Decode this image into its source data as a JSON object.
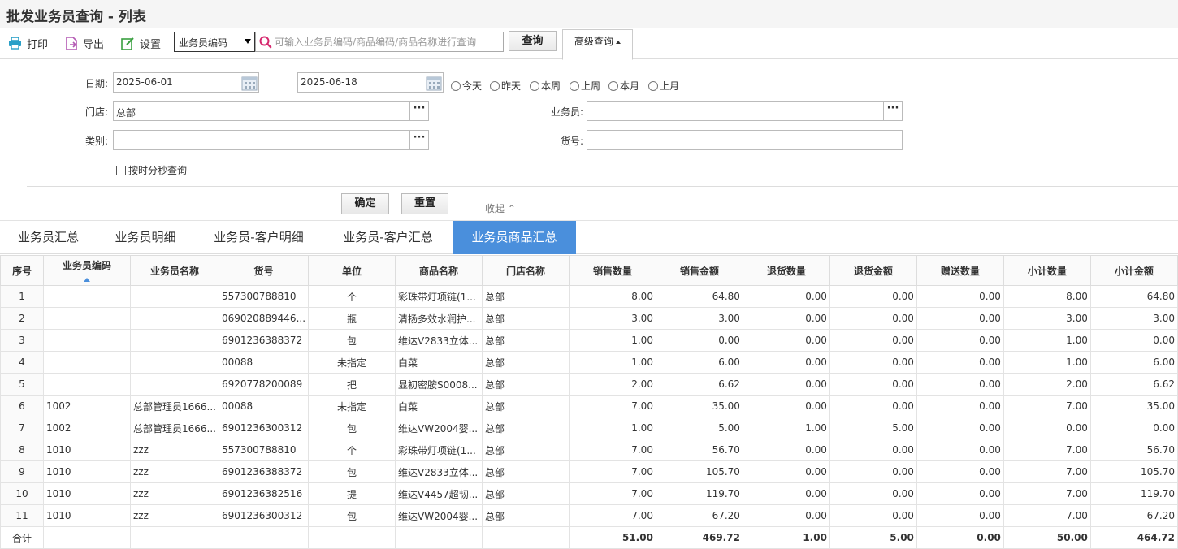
{
  "title": "批发业务员查询 - 列表",
  "toolbar": {
    "print": "打印",
    "export": "导出",
    "settings": "设置",
    "search_field": "业务员编码",
    "search_placeholder": "可输入业务员编码/商品编码/商品名称进行查询",
    "query": "查询",
    "advanced": "高级查询"
  },
  "filters": {
    "date_label": "日期:",
    "date_from": "2025-06-01",
    "date_sep": "--",
    "date_to": "2025-06-18",
    "quick": [
      "今天",
      "昨天",
      "本周",
      "上周",
      "本月",
      "上月"
    ],
    "store_label": "门店:",
    "store_value": "总部",
    "salesman_label": "业务员:",
    "salesman_value": "",
    "category_label": "类别:",
    "category_value": "",
    "item_no_label": "货号:",
    "item_no_value": "",
    "time_checkbox": "按时分秒查询",
    "confirm": "确定",
    "reset": "重置",
    "collapse": "收起"
  },
  "tabs": [
    "业务员汇总",
    "业务员明细",
    "业务员-客户明细",
    "业务员-客户汇总",
    "业务员商品汇总"
  ],
  "active_tab": 4,
  "table": {
    "headers": [
      "序号",
      "业务员编码",
      "业务员名称",
      "货号",
      "单位",
      "商品名称",
      "门店名称",
      "销售数量",
      "销售金额",
      "退货数量",
      "退货金额",
      "赠送数量",
      "小计数量",
      "小计金额"
    ],
    "rows": [
      [
        "1",
        "",
        "",
        "557300788810",
        "个",
        "彩珠带灯项链(1...",
        "总部",
        "8.00",
        "64.80",
        "0.00",
        "0.00",
        "0.00",
        "8.00",
        "64.80"
      ],
      [
        "2",
        "",
        "",
        "069020889446...",
        "瓶",
        "清扬多效水润护...",
        "总部",
        "3.00",
        "3.00",
        "0.00",
        "0.00",
        "0.00",
        "3.00",
        "3.00"
      ],
      [
        "3",
        "",
        "",
        "6901236388372",
        "包",
        "维达V2833立体...",
        "总部",
        "1.00",
        "0.00",
        "0.00",
        "0.00",
        "0.00",
        "1.00",
        "0.00"
      ],
      [
        "4",
        "",
        "",
        "00088",
        "未指定",
        "白菜",
        "总部",
        "1.00",
        "6.00",
        "0.00",
        "0.00",
        "0.00",
        "1.00",
        "6.00"
      ],
      [
        "5",
        "",
        "",
        "6920778200089",
        "把",
        "显初密胺S0008...",
        "总部",
        "2.00",
        "6.62",
        "0.00",
        "0.00",
        "0.00",
        "2.00",
        "6.62"
      ],
      [
        "6",
        "1002",
        "总部管理员1666...",
        "00088",
        "未指定",
        "白菜",
        "总部",
        "7.00",
        "35.00",
        "0.00",
        "0.00",
        "0.00",
        "7.00",
        "35.00"
      ],
      [
        "7",
        "1002",
        "总部管理员1666...",
        "6901236300312",
        "包",
        "维达VW2004婴...",
        "总部",
        "1.00",
        "5.00",
        "1.00",
        "5.00",
        "0.00",
        "0.00",
        "0.00"
      ],
      [
        "8",
        "1010",
        "zzz",
        "557300788810",
        "个",
        "彩珠带灯项链(1...",
        "总部",
        "7.00",
        "56.70",
        "0.00",
        "0.00",
        "0.00",
        "7.00",
        "56.70"
      ],
      [
        "9",
        "1010",
        "zzz",
        "6901236388372",
        "包",
        "维达V2833立体...",
        "总部",
        "7.00",
        "105.70",
        "0.00",
        "0.00",
        "0.00",
        "7.00",
        "105.70"
      ],
      [
        "10",
        "1010",
        "zzz",
        "6901236382516",
        "提",
        "维达V4457超韧...",
        "总部",
        "7.00",
        "119.70",
        "0.00",
        "0.00",
        "0.00",
        "7.00",
        "119.70"
      ],
      [
        "11",
        "1010",
        "zzz",
        "6901236300312",
        "包",
        "维达VW2004婴...",
        "总部",
        "7.00",
        "67.20",
        "0.00",
        "0.00",
        "0.00",
        "7.00",
        "67.20"
      ]
    ],
    "total_label": "合计",
    "totals": [
      "51.00",
      "469.72",
      "1.00",
      "5.00",
      "0.00",
      "50.00",
      "464.72"
    ]
  },
  "colors": {
    "accent": "#4a8fdc",
    "print_icon": "#2aa0c8",
    "export_icon": "#b45ab4",
    "settings_icon": "#3aa040",
    "search_icon": "#d6286e"
  }
}
